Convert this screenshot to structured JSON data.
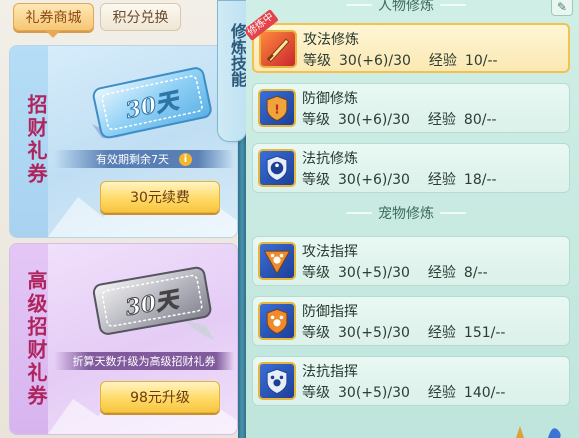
{
  "tabs": {
    "coupon_shop": "礼券商城",
    "points_exchange": "积分兑换"
  },
  "cards": [
    {
      "title": "招财礼券",
      "ticket_label": "30天",
      "info": "有效期剩余7天",
      "info_icon": "i",
      "button": "30元续费"
    },
    {
      "title": "高级招财礼券",
      "ticket_label": "30天",
      "info": "折算天数升级为高级招财礼券",
      "button": "98元升级"
    }
  ],
  "side_tab": "修炼技能",
  "sections": {
    "character": "人物修炼",
    "pet": "宠物修炼"
  },
  "edit_icon": "✎",
  "character_skills": [
    {
      "name": "攻法修炼",
      "level_label": "等级",
      "level": "30(+6)/30",
      "exp_label": "经验",
      "exp": "10/--",
      "badge": "修炼中",
      "icon": "sword-icon"
    },
    {
      "name": "防御修炼",
      "level_label": "等级",
      "level": "30(+6)/30",
      "exp_label": "经验",
      "exp": "80/--",
      "icon": "shield-icon"
    },
    {
      "name": "法抗修炼",
      "level_label": "等级",
      "level": "30(+6)/30",
      "exp_label": "经验",
      "exp": "18/--",
      "icon": "yinyang-icon"
    }
  ],
  "pet_skills": [
    {
      "name": "攻法指挥",
      "level_label": "等级",
      "level": "30(+5)/30",
      "exp_label": "经验",
      "exp": "8/--",
      "icon": "paw-attack-icon"
    },
    {
      "name": "防御指挥",
      "level_label": "等级",
      "level": "30(+5)/30",
      "exp_label": "经验",
      "exp": "151/--",
      "icon": "paw-shield-icon"
    },
    {
      "name": "法抗指挥",
      "level_label": "等级",
      "level": "30(+5)/30",
      "exp_label": "经验",
      "exp": "140/--",
      "icon": "paw-magic-icon"
    }
  ],
  "colors": {
    "title_pink": "#b0245d",
    "button_gold": "#ffd861",
    "selected_border": "#f3c14f",
    "badge_red": "#e5434b"
  }
}
